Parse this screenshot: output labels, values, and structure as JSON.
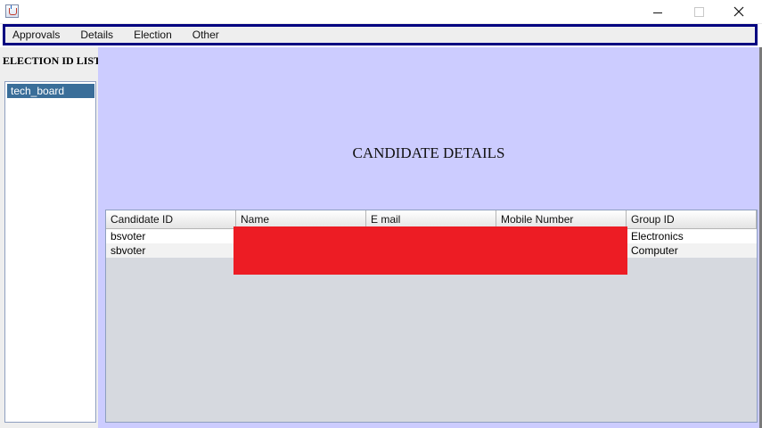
{
  "window": {
    "icon": "java-cup-icon",
    "controls": [
      "minimize",
      "maximize",
      "close"
    ]
  },
  "menubar": {
    "items": [
      "Approvals",
      "Details",
      "Election",
      "Other"
    ]
  },
  "sidebar": {
    "title": "ELECTION ID LIST",
    "items": [
      "tech_board"
    ],
    "selected_index": 0
  },
  "main": {
    "heading": "CANDIDATE DETAILS",
    "table": {
      "columns": [
        "Candidate ID",
        "Name",
        "E mail",
        "Mobile Number",
        "Group ID"
      ],
      "rows": [
        [
          "bsvoter",
          "",
          "",
          "",
          "Electronics"
        ],
        [
          "sbvoter",
          "",
          "",
          "",
          "Computer"
        ]
      ],
      "redacted_columns": [
        "Name",
        "E mail",
        "Mobile Number"
      ]
    }
  },
  "colors": {
    "menubar_border": "#000080",
    "detail_background": "#ccccff",
    "selection": "#3a6e99",
    "redaction": "#ed1c24"
  }
}
